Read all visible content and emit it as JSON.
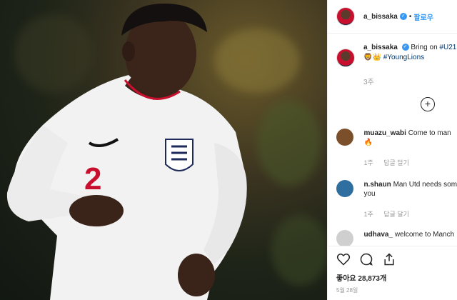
{
  "post": {
    "username": "a_bissaka",
    "follow_label": "팔로우",
    "caption_text": "Bring on ",
    "caption_tag1": "#U21",
    "caption_emoji": "🦁👑 ",
    "caption_tag2": "#YoungLions",
    "caption_time": "3주",
    "likes": "좋아요 28,873개",
    "date": "5월 28일"
  },
  "comments": [
    {
      "user": "muazu_wabi",
      "text": "Come to man",
      "extra": "🔥",
      "time": "1주",
      "reply": "답글 달기",
      "avatar_color": "#7a4f2a"
    },
    {
      "user": "n.shaun",
      "text": "Man Utd needs som",
      "extra": "you",
      "time": "1주",
      "reply": "답글 달기",
      "avatar_color": "#2f6f9f"
    },
    {
      "user": "udhava_",
      "text": "welcome to Manch",
      "extra": "",
      "time": "",
      "reply": "",
      "avatar_color": "#cfcfcf"
    }
  ],
  "colors": {
    "accent": "#3897f0",
    "hashtag": "#003569",
    "muted": "#999999"
  },
  "icons": [
    "verified-badge-icon",
    "plus-circle-icon",
    "heart-icon",
    "comment-icon",
    "share-icon"
  ]
}
